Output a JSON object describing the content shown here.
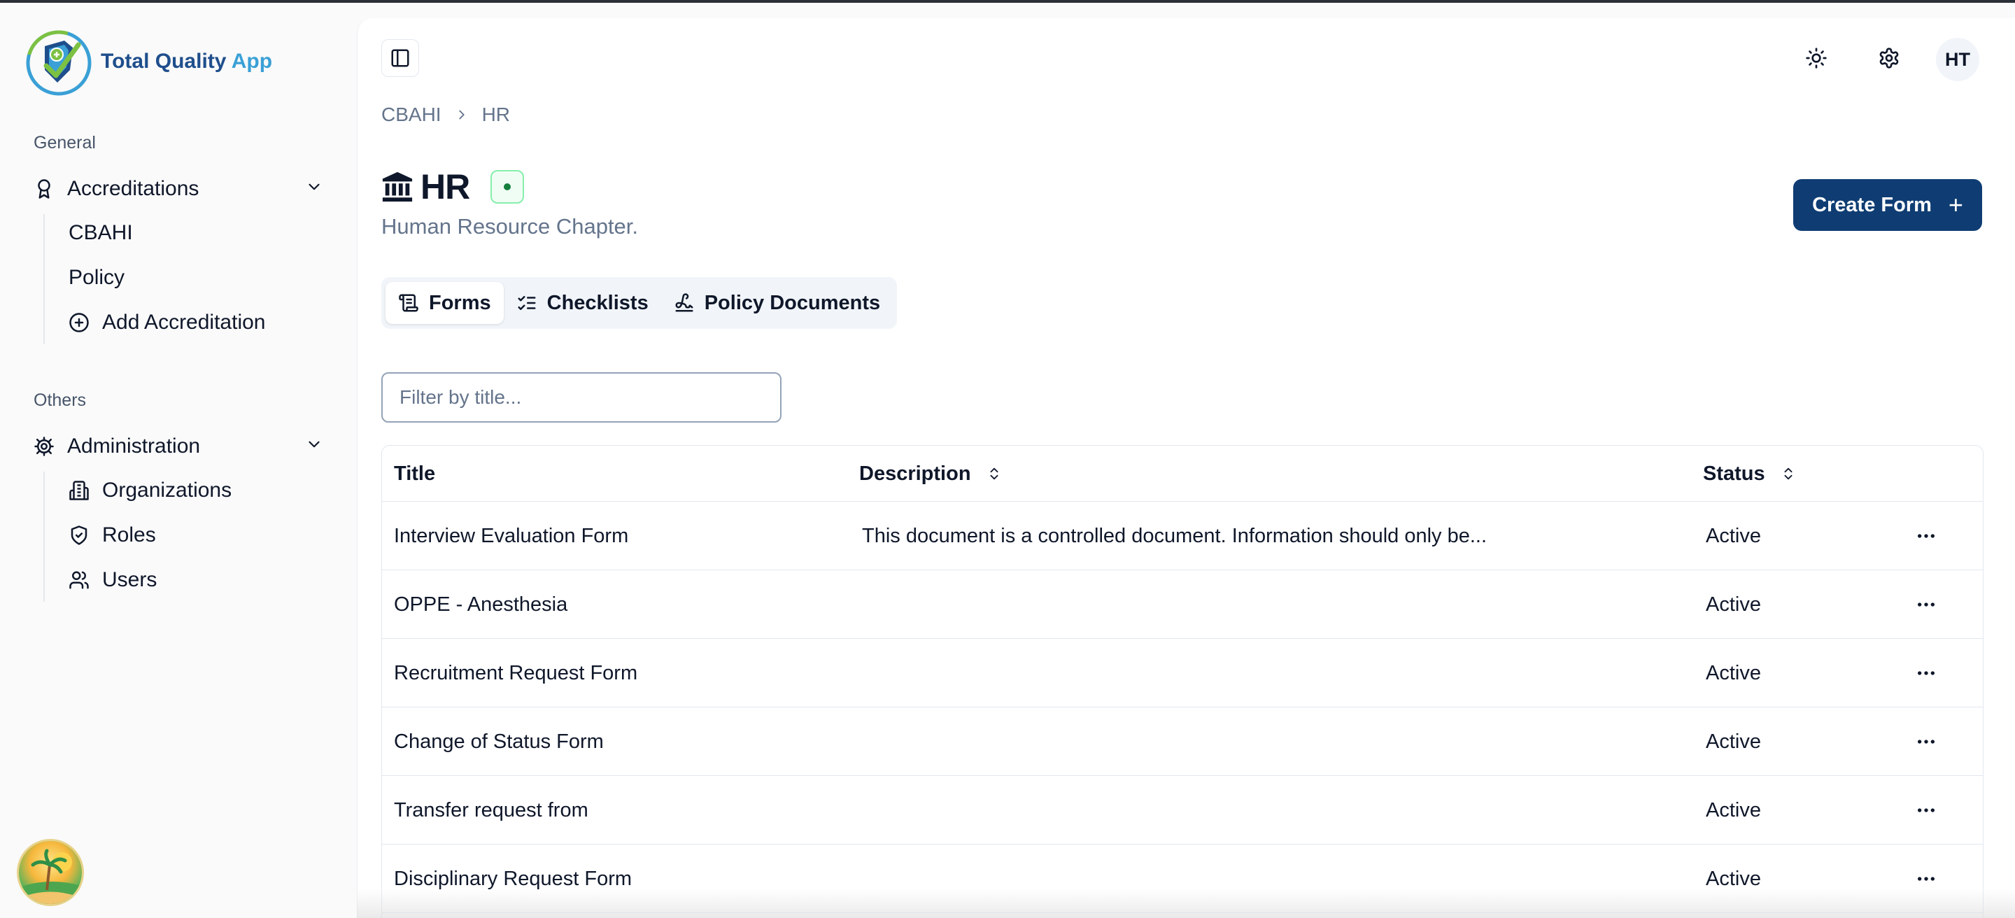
{
  "app": {
    "name_main": "Total Quality",
    "name_accent": "App"
  },
  "sidebar": {
    "general_label": "General",
    "accreditations": {
      "label": "Accreditations",
      "items": [
        {
          "label": "CBAHI"
        },
        {
          "label": "Policy"
        },
        {
          "label": "Add Accreditation",
          "icon": "plus-circle-icon"
        }
      ]
    },
    "others_label": "Others",
    "administration": {
      "label": "Administration",
      "items": [
        {
          "label": "Organizations",
          "icon": "building-icon"
        },
        {
          "label": "Roles",
          "icon": "shield-icon"
        },
        {
          "label": "Users",
          "icon": "users-icon"
        }
      ]
    }
  },
  "header": {
    "avatar_initials": "HT"
  },
  "breadcrumb": {
    "items": [
      "CBAHI",
      "HR"
    ]
  },
  "page": {
    "title": "HR",
    "subtitle": "Human Resource Chapter.",
    "create_button": "Create Form"
  },
  "tabs": [
    {
      "label": "Forms",
      "active": true
    },
    {
      "label": "Checklists",
      "active": false
    },
    {
      "label": "Policy Documents",
      "active": false
    }
  ],
  "filter": {
    "placeholder": "Filter by title..."
  },
  "table": {
    "columns": [
      "Title",
      "Description",
      "Status"
    ],
    "rows": [
      {
        "title": "Interview Evaluation Form",
        "description": "This document is a controlled document. Information should only be...",
        "status": "Active"
      },
      {
        "title": "OPPE - Anesthesia",
        "description": "",
        "status": "Active"
      },
      {
        "title": "Recruitment Request Form",
        "description": "",
        "status": "Active"
      },
      {
        "title": "Change of Status Form",
        "description": "",
        "status": "Active"
      },
      {
        "title": "Transfer request from",
        "description": "",
        "status": "Active"
      },
      {
        "title": "Disciplinary Request Form",
        "description": "",
        "status": "Active"
      }
    ]
  },
  "colors": {
    "primary": "#0f3d73",
    "active_status": "#15803d"
  }
}
